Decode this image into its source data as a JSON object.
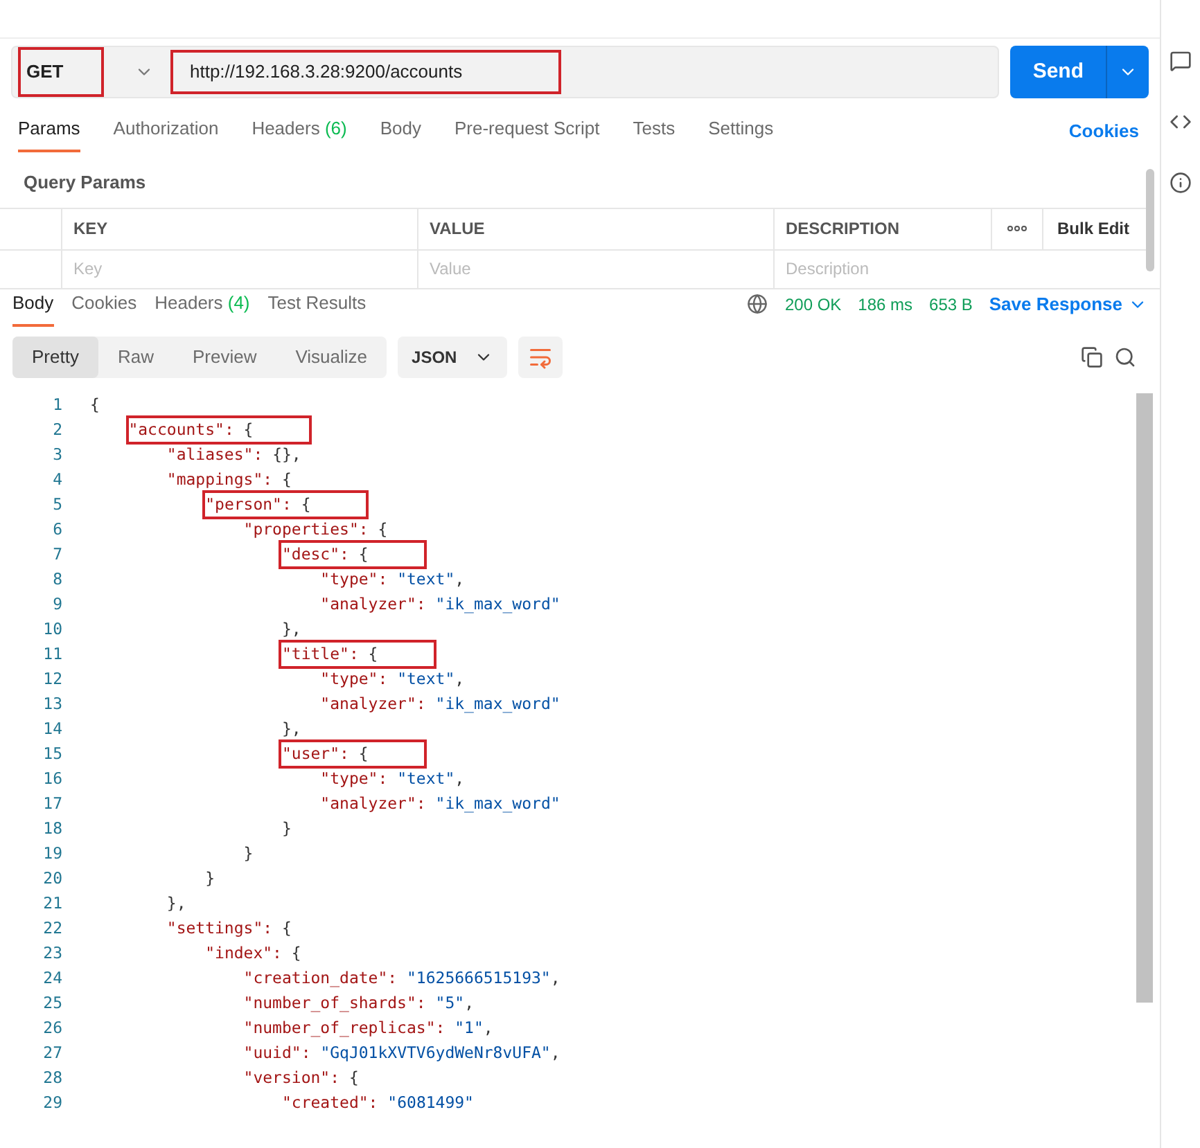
{
  "request": {
    "method": "GET",
    "method_highlighted": true,
    "url": "http://192.168.3.28:9200/accounts",
    "url_highlighted": true,
    "send": "Send"
  },
  "request_tabs": [
    {
      "label": "Params",
      "selected": true
    },
    {
      "label": "Authorization",
      "selected": false
    },
    {
      "label": "Headers",
      "count": "(6)",
      "selected": false
    },
    {
      "label": "Body",
      "selected": false
    },
    {
      "label": "Pre-request Script",
      "selected": false
    },
    {
      "label": "Tests",
      "selected": false
    },
    {
      "label": "Settings",
      "selected": false
    }
  ],
  "cookies_link": "Cookies",
  "query_params": {
    "title": "Query Params",
    "columns": [
      "KEY",
      "VALUE",
      "DESCRIPTION"
    ],
    "bulk_edit": "Bulk Edit",
    "placeholders": [
      "Key",
      "Value",
      "Description"
    ]
  },
  "response_tabs": [
    {
      "label": "Body",
      "selected": true
    },
    {
      "label": "Cookies",
      "selected": false
    },
    {
      "label": "Headers",
      "count": "(4)",
      "selected": false
    },
    {
      "label": "Test Results",
      "selected": false
    }
  ],
  "response_status": {
    "status": "200 OK",
    "time": "186 ms",
    "size": "653 B",
    "save": "Save Response"
  },
  "view_modes": [
    {
      "label": "Pretty",
      "selected": true
    },
    {
      "label": "Raw",
      "selected": false
    },
    {
      "label": "Preview",
      "selected": false
    },
    {
      "label": "Visualize",
      "selected": false
    }
  ],
  "format": "JSON",
  "code_lines": [
    {
      "n": "1",
      "text": "{",
      "highlighted": false
    },
    {
      "n": "2",
      "text": "    \"accounts\": {",
      "highlighted": true
    },
    {
      "n": "3",
      "text": "        \"aliases\": {},",
      "highlighted": false
    },
    {
      "n": "4",
      "text": "        \"mappings\": {",
      "highlighted": false
    },
    {
      "n": "5",
      "text": "            \"person\": {",
      "highlighted": true
    },
    {
      "n": "6",
      "text": "                \"properties\": {",
      "highlighted": false
    },
    {
      "n": "7",
      "text": "                    \"desc\": {",
      "highlighted": true
    },
    {
      "n": "8",
      "text": "                        \"type\": \"text\",",
      "highlighted": false
    },
    {
      "n": "9",
      "text": "                        \"analyzer\": \"ik_max_word\"",
      "highlighted": false
    },
    {
      "n": "10",
      "text": "                    },",
      "highlighted": false
    },
    {
      "n": "11",
      "text": "                    \"title\": {",
      "highlighted": true
    },
    {
      "n": "12",
      "text": "                        \"type\": \"text\",",
      "highlighted": false
    },
    {
      "n": "13",
      "text": "                        \"analyzer\": \"ik_max_word\"",
      "highlighted": false
    },
    {
      "n": "14",
      "text": "                    },",
      "highlighted": false
    },
    {
      "n": "15",
      "text": "                    \"user\": {",
      "highlighted": true
    },
    {
      "n": "16",
      "text": "                        \"type\": \"text\",",
      "highlighted": false
    },
    {
      "n": "17",
      "text": "                        \"analyzer\": \"ik_max_word\"",
      "highlighted": false
    },
    {
      "n": "18",
      "text": "                    }",
      "highlighted": false
    },
    {
      "n": "19",
      "text": "                }",
      "highlighted": false
    },
    {
      "n": "20",
      "text": "            }",
      "highlighted": false
    },
    {
      "n": "21",
      "text": "        },",
      "highlighted": false
    },
    {
      "n": "22",
      "text": "        \"settings\": {",
      "highlighted": false
    },
    {
      "n": "23",
      "text": "            \"index\": {",
      "highlighted": false
    },
    {
      "n": "24",
      "text": "                \"creation_date\": \"1625666515193\",",
      "highlighted": false
    },
    {
      "n": "25",
      "text": "                \"number_of_shards\": \"5\",",
      "highlighted": false
    },
    {
      "n": "26",
      "text": "                \"number_of_replicas\": \"1\",",
      "highlighted": false
    },
    {
      "n": "27",
      "text": "                \"uuid\": \"GqJ01kXVTV6ydWeNr8vUFA\",",
      "highlighted": false
    },
    {
      "n": "28",
      "text": "                \"version\": {",
      "highlighted": false
    },
    {
      "n": "29",
      "text": "                    \"created\": \"6081499\"",
      "highlighted": false
    }
  ]
}
